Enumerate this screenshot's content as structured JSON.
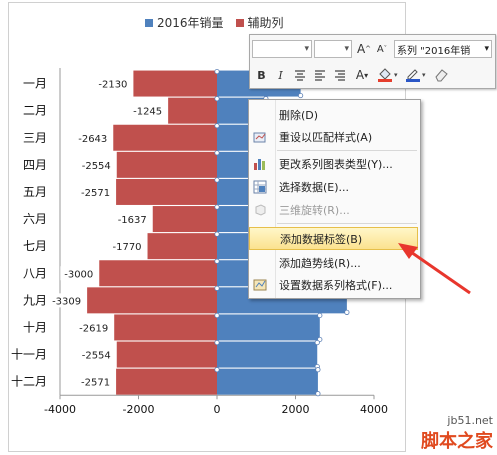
{
  "chart_data": {
    "type": "bar",
    "orientation": "horizontal",
    "categories": [
      "一月",
      "二月",
      "三月",
      "四月",
      "五月",
      "六月",
      "七月",
      "八月",
      "九月",
      "十月",
      "十一月",
      "十二月"
    ],
    "series": [
      {
        "name": "2016年销量",
        "color": "#4f81bd",
        "values": [
          2130,
          1245,
          2643,
          2554,
          2571,
          1637,
          1770,
          3000,
          3309,
          2619,
          2554,
          2571
        ]
      },
      {
        "name": "辅助列",
        "color": "#c0504d",
        "values": [
          -2130,
          -1245,
          -2643,
          -2554,
          -2571,
          -1637,
          -1770,
          -3000,
          -3309,
          -2619,
          -2554,
          -2571
        ]
      }
    ],
    "data_labels": [
      "-2130",
      "-1245",
      "-2643",
      "-2554",
      "-2571",
      "-1637",
      "-1770",
      "-3000",
      "-3309",
      "-2619",
      "-2554",
      "-2571"
    ],
    "xlim": [
      -4000,
      4000
    ],
    "x_ticks": [
      "-4000",
      "-2000",
      "0",
      "2000",
      "4000"
    ],
    "grid": false,
    "legend": "top"
  },
  "toolbar": {
    "series_combo": "系列 \"2016年销",
    "grow_font": "A",
    "shrink_font": "A",
    "bold": "B",
    "italic": "I",
    "font_color": "A"
  },
  "context_menu": {
    "items": [
      {
        "label": "删除(D)",
        "icon": "none",
        "enabled": true
      },
      {
        "label": "重设以匹配样式(A)",
        "icon": "reset-style-icon",
        "enabled": true
      },
      {
        "label": "更改系列图表类型(Y)...",
        "icon": "chart-type-icon",
        "enabled": true
      },
      {
        "label": "选择数据(E)...",
        "icon": "select-data-icon",
        "enabled": true
      },
      {
        "label": "三维旋转(R)...",
        "icon": "rotate-3d-icon",
        "enabled": false
      },
      {
        "label": "添加数据标签(B)",
        "icon": "none",
        "enabled": true,
        "highlighted": true
      },
      {
        "label": "添加趋势线(R)...",
        "icon": "none",
        "enabled": true
      },
      {
        "label": "设置数据系列格式(F)...",
        "icon": "format-series-icon",
        "enabled": true
      }
    ]
  },
  "annotation": {
    "arrow_color": "#e8362d"
  },
  "watermark": {
    "site": "jb51.net",
    "name": "脚本之家"
  }
}
